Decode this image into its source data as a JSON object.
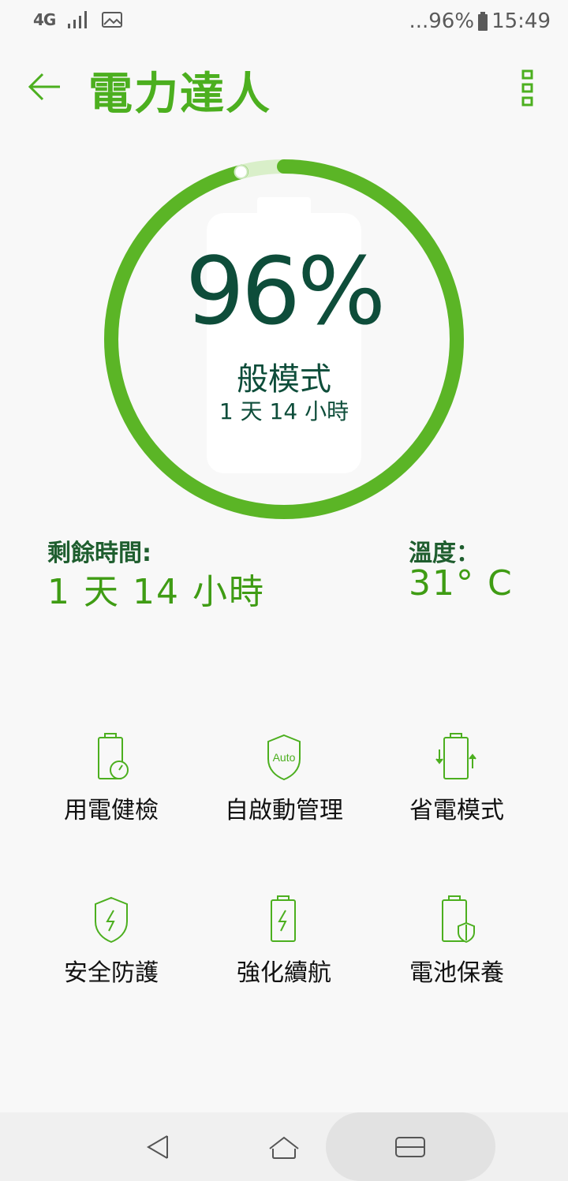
{
  "status_bar": {
    "network": "4G",
    "battery_text": "...96%",
    "time": "15:49"
  },
  "app_bar": {
    "title": "電力達人"
  },
  "gauge": {
    "percent_text": "96%",
    "level_percent": 96,
    "mode": "般模式",
    "remaining": "1 天 14 小時"
  },
  "info": {
    "remaining_label": "剩餘時間:",
    "remaining_value": "1 天 14 小時",
    "temperature_label": "溫度：",
    "temperature_value": "31° C"
  },
  "features": [
    {
      "label": "用電健檢",
      "icon": "battery-gauge-icon"
    },
    {
      "label": "自啟動管理",
      "icon": "auto-shield-icon"
    },
    {
      "label": "省電模式",
      "icon": "battery-cycle-icon"
    },
    {
      "label": "安全防護",
      "icon": "shield-bolt-icon"
    },
    {
      "label": "強化續航",
      "icon": "battery-bolt-icon"
    },
    {
      "label": "電池保養",
      "icon": "battery-shield-icon"
    }
  ],
  "colors": {
    "accent": "#4caf1f",
    "dark_green": "#0e4d3a",
    "value_green": "#3f9c14"
  }
}
